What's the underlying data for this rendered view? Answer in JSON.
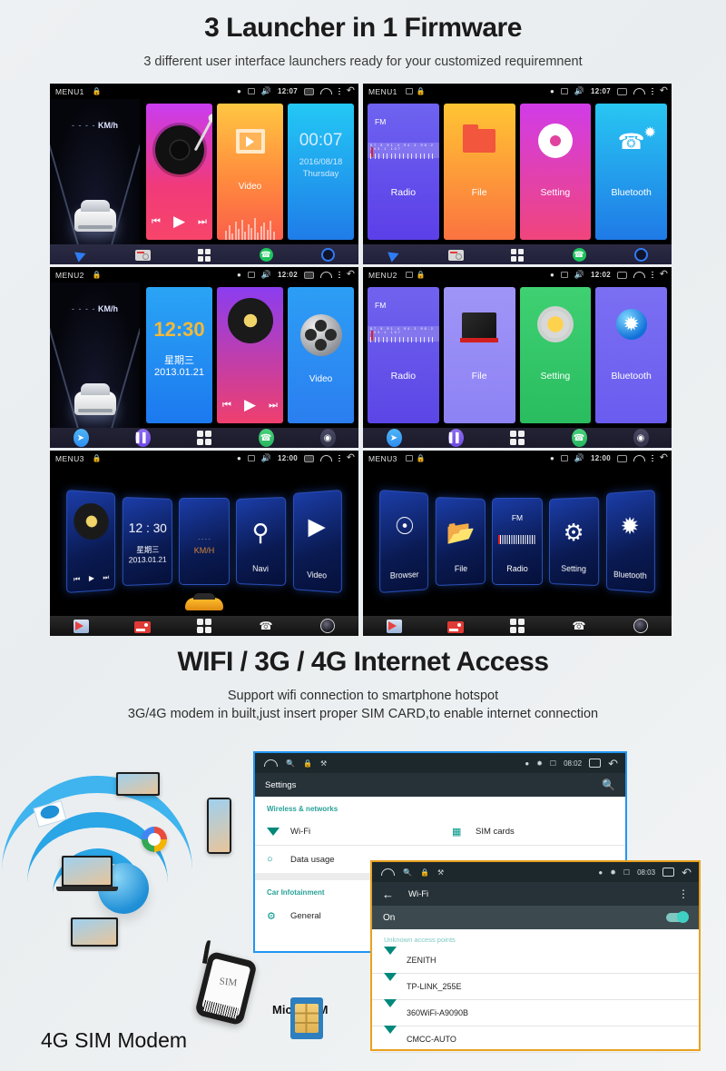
{
  "section1": {
    "title": "3 Launcher in 1 Firmware",
    "subtitle": "3 different user interface launchers ready for your customized requiremnent"
  },
  "section2": {
    "title": "WIFI / 3G / 4G Internet Access",
    "subtitle_1": "Support wifi connection to smartphone hotspot",
    "subtitle_2": "3G/4G modem in built,just insert proper SIM CARD,to enable internet connection"
  },
  "launchers": [
    {
      "id": "menu1-home",
      "menu_label": "MENU1",
      "clock": "12:07",
      "widget_speed": "KM/h",
      "widget_speed_dash": "- - - -",
      "cards": [
        {
          "name": "music",
          "label": ""
        },
        {
          "name": "video",
          "label": "Video"
        },
        {
          "name": "clock",
          "time": "00:07",
          "date": "2016/08/18",
          "weekday": "Thursday"
        }
      ],
      "dock": [
        "navigation-icon",
        "radio-icon",
        "apps-icon",
        "phone-icon",
        "assistant-icon"
      ]
    },
    {
      "id": "menu1-apps",
      "menu_label": "MENU1",
      "clock": "12:07",
      "apps": [
        {
          "label": "Radio",
          "fm": "FM",
          "tuner": "87.5  91.4  94.3  98.2 103.1  107"
        },
        {
          "label": "File"
        },
        {
          "label": "Setting"
        },
        {
          "label": "Bluetooth"
        }
      ],
      "dock": [
        "navigation-icon",
        "radio-icon",
        "apps-icon",
        "phone-icon",
        "assistant-icon"
      ]
    },
    {
      "id": "menu2-home",
      "menu_label": "MENU2",
      "clock": "12:02",
      "widget_speed": "KM/h",
      "widget_speed_dash": "- - - -",
      "cards": [
        {
          "name": "clock",
          "time": "12:30",
          "weekday": "星期三",
          "date": "2013.01.21"
        },
        {
          "name": "music",
          "label": ""
        },
        {
          "name": "video",
          "label": "Video"
        }
      ],
      "dock": [
        "navigation-icon",
        "music-icon",
        "apps-icon",
        "phone-icon",
        "assistant-icon"
      ]
    },
    {
      "id": "menu2-apps",
      "menu_label": "MENU2",
      "clock": "12:02",
      "apps": [
        {
          "label": "Radio",
          "fm": "FM",
          "tuner": "87.5  91.4  94.3  98.2 103.1  107"
        },
        {
          "label": "File"
        },
        {
          "label": "Setting"
        },
        {
          "label": "Bluetooth"
        }
      ],
      "dock": [
        "navigation-icon",
        "music-icon",
        "apps-icon",
        "phone-icon",
        "assistant-icon"
      ]
    },
    {
      "id": "menu3-home",
      "menu_label": "MENU3",
      "clock": "12:00",
      "tiles": [
        {
          "label": "",
          "name": "music-tile"
        },
        {
          "label": "",
          "time": "12 : 30",
          "weekday": "星期三",
          "date": "2013.01.21",
          "name": "clock-tile"
        },
        {
          "label": "KM/H",
          "name": "speed-tile"
        },
        {
          "label": "Navi",
          "name": "navi-tile"
        },
        {
          "label": "Video",
          "name": "video-tile"
        }
      ],
      "dock": [
        "navigation-icon",
        "radio-icon",
        "apps-icon",
        "phone-bluetooth-icon",
        "camera-icon"
      ]
    },
    {
      "id": "menu3-apps",
      "menu_label": "MENU3",
      "clock": "12:00",
      "tiles": [
        {
          "label": "Browser",
          "name": "browser-tile"
        },
        {
          "label": "File",
          "name": "file-tile"
        },
        {
          "label": "Radio",
          "fm": "FM",
          "name": "radio-tile"
        },
        {
          "label": "Setting",
          "name": "setting-tile"
        },
        {
          "label": "Bluetooth",
          "name": "bluetooth-tile"
        }
      ],
      "dock": [
        "navigation-icon",
        "radio-icon",
        "apps-icon",
        "phone-bluetooth-icon",
        "camera-icon"
      ]
    }
  ],
  "settings_window": {
    "clock": "08:02",
    "title": "Settings",
    "section_wireless": "Wireless & networks",
    "row_wifi": "Wi-Fi",
    "row_sim": "SIM cards",
    "row_data": "Data usage",
    "section_car": "Car Infotainment",
    "row_general": "General"
  },
  "wifi_window": {
    "clock": "08:03",
    "title": "Wi-Fi",
    "toggle_state": "On",
    "section_unknown": "Unknown access points",
    "networks": [
      "ZENITH",
      "TP-LINK_255E",
      "360WiFi-A9090B",
      "CMCC-AUTO"
    ]
  },
  "captions": {
    "modem": "4G SIM Modem",
    "micro_sim": "Micro SIM"
  },
  "colors": {
    "settings_border": "#2196f3",
    "wifi_border": "#e8a11f",
    "teal": "#009688",
    "android_dark": "#263238"
  }
}
